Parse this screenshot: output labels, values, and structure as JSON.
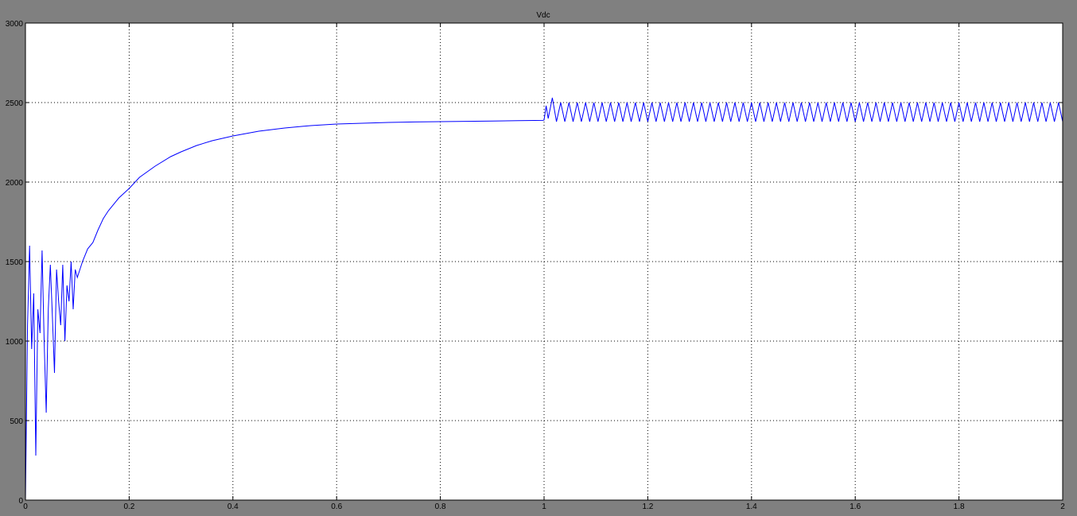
{
  "chart_data": {
    "type": "line",
    "title": "Vdc",
    "xlabel": "",
    "ylabel": "",
    "xlim": [
      0,
      2
    ],
    "ylim": [
      0,
      3000
    ],
    "grid": true,
    "x_ticks": [
      0,
      0.2,
      0.4,
      0.6,
      0.8,
      1,
      1.2,
      1.4,
      1.6,
      1.8,
      2
    ],
    "x_tick_labels": [
      "0",
      "0.2",
      "0.4",
      "0.6",
      "0.8",
      "1",
      "1.2",
      "1.4",
      "1.6",
      "1.8",
      "2"
    ],
    "y_ticks": [
      0,
      500,
      1000,
      1500,
      2000,
      2500,
      3000
    ],
    "y_tick_labels": [
      "0",
      "500",
      "1000",
      "1500",
      "2000",
      "2500",
      "3000"
    ],
    "colors": {
      "background": "#808080",
      "axes_face": "#ffffff",
      "series": "#0000ff",
      "grid": "#000000"
    },
    "series": [
      {
        "x": [
          0,
          0.004,
          0.008,
          0.012,
          0.016,
          0.02,
          0.024,
          0.028,
          0.032,
          0.036,
          0.04,
          0.044,
          0.048,
          0.052,
          0.056,
          0.06,
          0.064,
          0.068,
          0.072,
          0.076,
          0.08,
          0.084,
          0.088,
          0.092,
          0.096,
          0.1,
          0.11,
          0.12,
          0.13,
          0.14,
          0.15,
          0.16,
          0.18,
          0.2,
          0.22,
          0.25,
          0.28,
          0.3,
          0.33,
          0.36,
          0.4,
          0.45,
          0.5,
          0.55,
          0.6,
          0.65,
          0.7,
          0.75,
          0.8,
          0.85,
          0.9,
          0.95,
          0.998,
          1.0,
          1.004,
          1.008,
          1.016,
          1.024,
          1.032,
          1.04,
          1.048,
          1.056,
          1.064,
          1.072,
          1.08,
          1.088,
          1.096,
          1.104,
          1.112,
          1.12,
          1.128,
          1.136,
          1.144,
          1.152,
          1.16,
          1.168,
          1.176,
          1.184,
          1.192,
          1.2,
          1.208,
          1.216,
          1.224,
          1.232,
          1.24,
          1.248,
          1.256,
          1.264,
          1.272,
          1.28,
          1.288,
          1.296,
          1.304,
          1.312,
          1.32,
          1.328,
          1.336,
          1.344,
          1.352,
          1.36,
          1.368,
          1.376,
          1.384,
          1.392,
          1.4,
          1.408,
          1.416,
          1.424,
          1.432,
          1.44,
          1.448,
          1.456,
          1.464,
          1.472,
          1.48,
          1.488,
          1.496,
          1.504,
          1.512,
          1.52,
          1.528,
          1.536,
          1.544,
          1.552,
          1.56,
          1.568,
          1.576,
          1.584,
          1.592,
          1.6,
          1.608,
          1.616,
          1.624,
          1.632,
          1.64,
          1.648,
          1.656,
          1.664,
          1.672,
          1.68,
          1.688,
          1.696,
          1.704,
          1.712,
          1.72,
          1.728,
          1.736,
          1.744,
          1.752,
          1.76,
          1.768,
          1.776,
          1.784,
          1.792,
          1.8,
          1.808,
          1.816,
          1.824,
          1.832,
          1.84,
          1.848,
          1.856,
          1.864,
          1.872,
          1.88,
          1.888,
          1.896,
          1.904,
          1.912,
          1.92,
          1.928,
          1.936,
          1.944,
          1.952,
          1.96,
          1.968,
          1.976,
          1.984,
          1.992,
          2.0
        ],
        "values": [
          0,
          1100,
          1600,
          950,
          1300,
          280,
          1200,
          1050,
          1570,
          1000,
          550,
          1200,
          1480,
          1150,
          800,
          1450,
          1250,
          1100,
          1480,
          1000,
          1350,
          1250,
          1500,
          1200,
          1450,
          1400,
          1500,
          1580,
          1620,
          1700,
          1770,
          1820,
          1900,
          1960,
          2030,
          2100,
          2160,
          2190,
          2230,
          2260,
          2290,
          2320,
          2340,
          2355,
          2365,
          2370,
          2375,
          2378,
          2380,
          2382,
          2384,
          2386,
          2388,
          2390,
          2480,
          2400,
          2530,
          2380,
          2500,
          2380,
          2500,
          2380,
          2500,
          2380,
          2500,
          2380,
          2500,
          2380,
          2500,
          2380,
          2500,
          2380,
          2500,
          2380,
          2500,
          2380,
          2500,
          2380,
          2500,
          2380,
          2500,
          2380,
          2500,
          2380,
          2500,
          2380,
          2500,
          2380,
          2500,
          2380,
          2500,
          2380,
          2500,
          2380,
          2500,
          2380,
          2500,
          2380,
          2500,
          2380,
          2500,
          2380,
          2500,
          2380,
          2500,
          2380,
          2500,
          2380,
          2500,
          2380,
          2500,
          2380,
          2500,
          2380,
          2500,
          2380,
          2500,
          2380,
          2500,
          2380,
          2500,
          2380,
          2500,
          2380,
          2500,
          2380,
          2500,
          2380,
          2500,
          2380,
          2500,
          2380,
          2500,
          2380,
          2500,
          2380,
          2500,
          2380,
          2500,
          2380,
          2500,
          2380,
          2500,
          2380,
          2500,
          2380,
          2500,
          2380,
          2500,
          2380,
          2500,
          2380,
          2500,
          2380,
          2500,
          2380,
          2500,
          2380,
          2500,
          2380,
          2500,
          2380,
          2500,
          2380,
          2500,
          2380,
          2500,
          2380,
          2500,
          2380,
          2500,
          2380,
          2500,
          2380,
          2500,
          2380,
          2500,
          2380,
          2500,
          2380
        ]
      }
    ]
  }
}
